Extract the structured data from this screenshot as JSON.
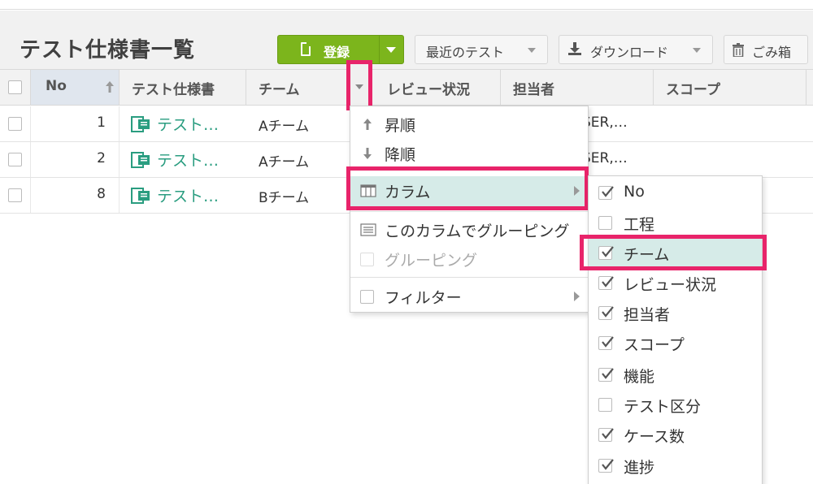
{
  "page": {
    "title": "テスト仕様書一覧"
  },
  "toolbar": {
    "register_label": "登録",
    "recent_label": "最近のテスト",
    "download_label": "ダウンロード",
    "trash_label": "ごみ箱"
  },
  "table": {
    "headers": [
      "No",
      "テスト仕様書",
      "チーム",
      "レビュー状況",
      "担当者",
      "スコープ"
    ],
    "rows": [
      {
        "no": "1",
        "spec": "テスト…",
        "team": "Aチーム",
        "assignee": "SER,…"
      },
      {
        "no": "2",
        "spec": "テスト…",
        "team": "Aチーム",
        "assignee": "SER,…"
      },
      {
        "no": "8",
        "spec": "テスト…",
        "team": "Bチーム",
        "assignee": ""
      }
    ]
  },
  "column_menu": {
    "items": [
      {
        "label": "昇順",
        "icon": "arrow-up-icon"
      },
      {
        "label": "降順",
        "icon": "arrow-down-icon"
      },
      {
        "label": "カラム",
        "icon": "columns-icon"
      },
      {
        "label": "このカラムでグルーピング",
        "icon": "group-icon"
      },
      {
        "label": "グルーピング",
        "icon": "checkbox-icon"
      },
      {
        "label": "フィルター",
        "icon": "checkbox-icon"
      }
    ]
  },
  "column_submenu": {
    "items": [
      {
        "label": "No",
        "checked": true
      },
      {
        "label": "工程",
        "checked": false
      },
      {
        "label": "チーム",
        "checked": true
      },
      {
        "label": "レビュー状況",
        "checked": true
      },
      {
        "label": "担当者",
        "checked": true
      },
      {
        "label": "スコープ",
        "checked": true
      },
      {
        "label": "機能",
        "checked": true
      },
      {
        "label": "テスト区分",
        "checked": false
      },
      {
        "label": "ケース数",
        "checked": true
      },
      {
        "label": "進捗",
        "checked": true
      }
    ]
  },
  "colors": {
    "accent_green": "#7cb51c",
    "link_teal": "#2a9d80",
    "highlight_pink": "#e8246a",
    "active_menu_bg": "#d6ebe8"
  }
}
